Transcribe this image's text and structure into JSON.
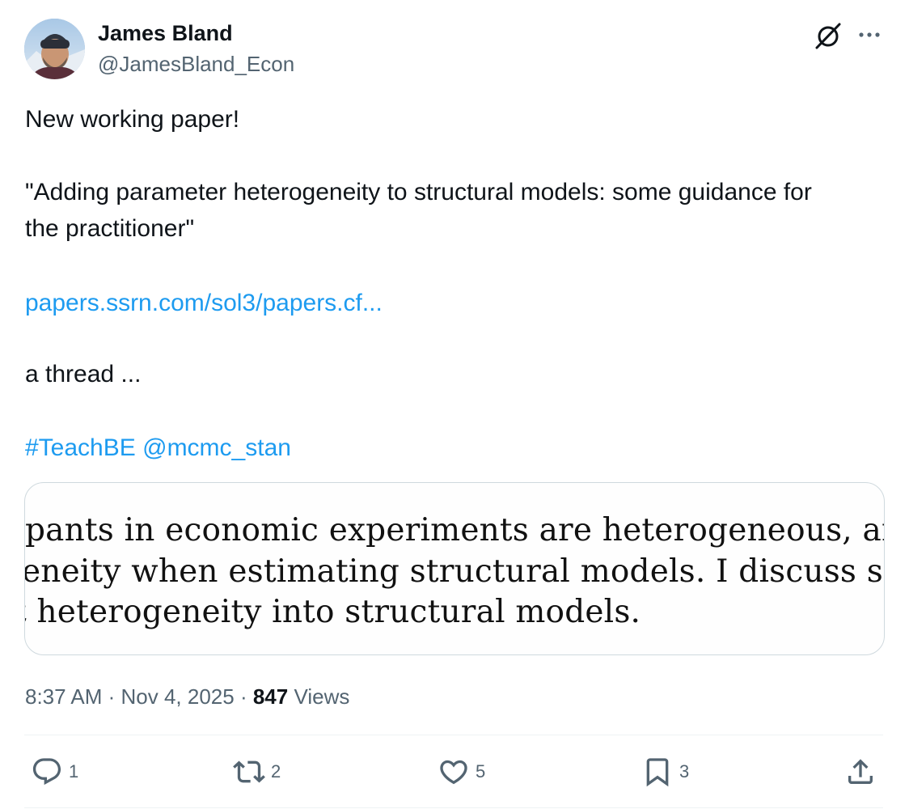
{
  "author": {
    "display_name": "James Bland",
    "handle": "@JamesBland_Econ",
    "avatar_icon": "profile-photo"
  },
  "header_actions": {
    "grok_icon": "grok-icon",
    "more_icon": "more-icon"
  },
  "tweet": {
    "line1": "New working paper!",
    "line2": "\"Adding parameter heterogeneity to structural models: some guidance for",
    "line3": "the practitioner\"",
    "link": "papers.ssrn.com/sol3/papers.cf...",
    "line4": "a thread ...",
    "hashtag": "#TeachBE",
    "mention": "@mcmc_stan"
  },
  "media": {
    "line1": "pants in economic experiments are heterogeneous, and so",
    "line2": "eneity when estimating structural models. I discuss several v",
    "line3": "t heterogeneity into structural models."
  },
  "meta": {
    "time": "8:37 AM",
    "sep1": " · ",
    "date": "Nov 4, 2025",
    "sep2": " · ",
    "views_count": "847",
    "views_label": " Views"
  },
  "actions": {
    "replies": "1",
    "reposts": "2",
    "likes": "5",
    "bookmarks": "3"
  },
  "colors": {
    "link": "#1d9bf0",
    "secondary_text": "#536471",
    "primary_text": "#0f1419",
    "border": "#cfd9de"
  }
}
